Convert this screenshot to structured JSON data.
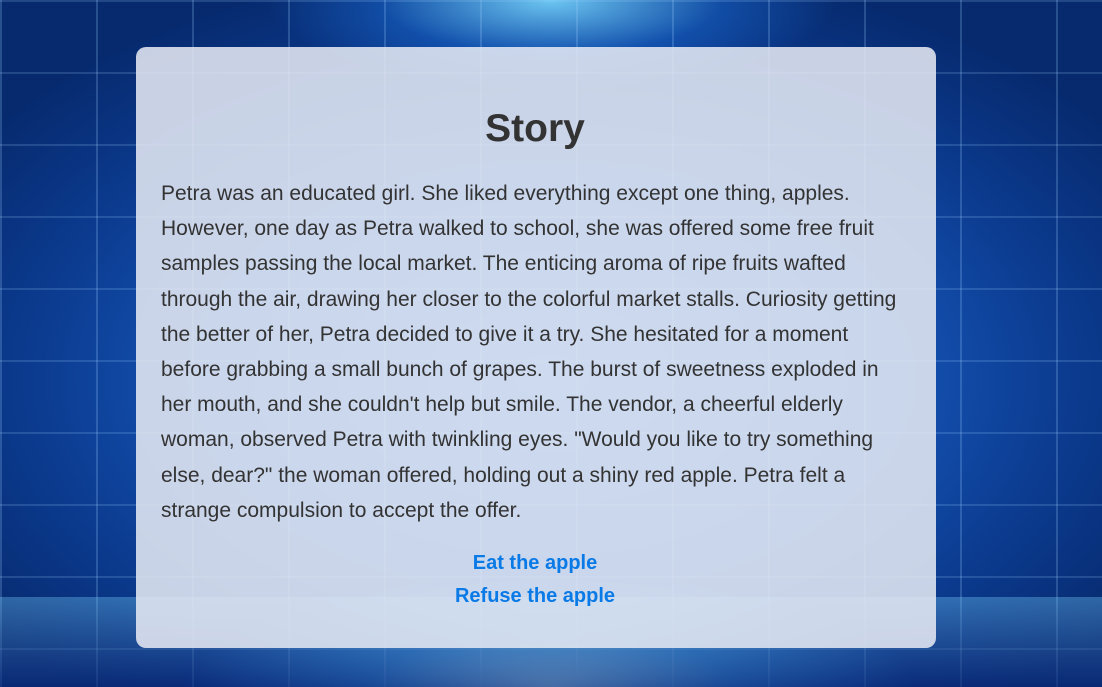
{
  "story": {
    "title": "Story",
    "text": "Petra was an educated girl. She liked everything except one thing, apples. However, one day as Petra walked to school, she was offered some free fruit samples passing the local market. The enticing aroma of ripe fruits wafted through the air, drawing her closer to the colorful market stalls. Curiosity getting the better of her, Petra decided to give it a try. She hesitated for a moment before grabbing a small bunch of grapes. The burst of sweetness exploded in her mouth, and she couldn't help but smile. The vendor, a cheerful elderly woman, observed Petra with twinkling eyes. \"Would you like to try something else, dear?\" the woman offered, holding out a shiny red apple. Petra felt a strange compulsion to accept the offer.",
    "choices": [
      {
        "label": "Eat the apple"
      },
      {
        "label": "Refuse the apple"
      }
    ]
  },
  "colors": {
    "text": "#333333",
    "link": "#0a7ae6",
    "card": "#e4e8f2",
    "background": "#1656b8"
  }
}
